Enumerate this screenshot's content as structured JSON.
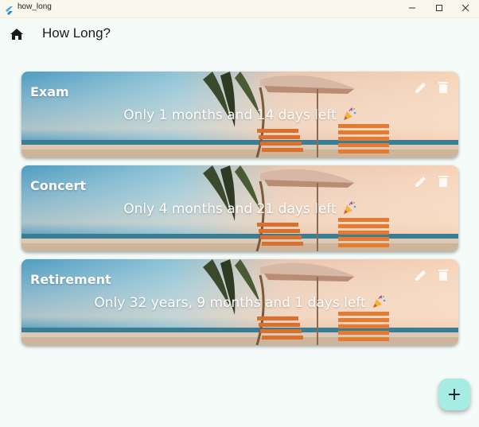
{
  "window": {
    "title": "how_long"
  },
  "appbar": {
    "title": "How Long?"
  },
  "cards": [
    {
      "title": "Exam",
      "message": "Only 1 months and 14 days left"
    },
    {
      "title": "Concert",
      "message": "Only 4 months and 21 days left"
    },
    {
      "title": "Retirement",
      "message": "Only 32 years, 9 months and 1 days left"
    }
  ],
  "fab": {
    "label": "+"
  },
  "icons": {
    "home": "home-icon",
    "edit": "pencil-icon",
    "delete": "trash-icon",
    "party": "party-popper-icon",
    "minimize": "minimize-icon",
    "maximize": "maximize-icon",
    "close": "close-icon"
  },
  "colors": {
    "background": "#f5fbf8",
    "titlebar": "#f9f6ec",
    "fab": "#a6ece4"
  }
}
